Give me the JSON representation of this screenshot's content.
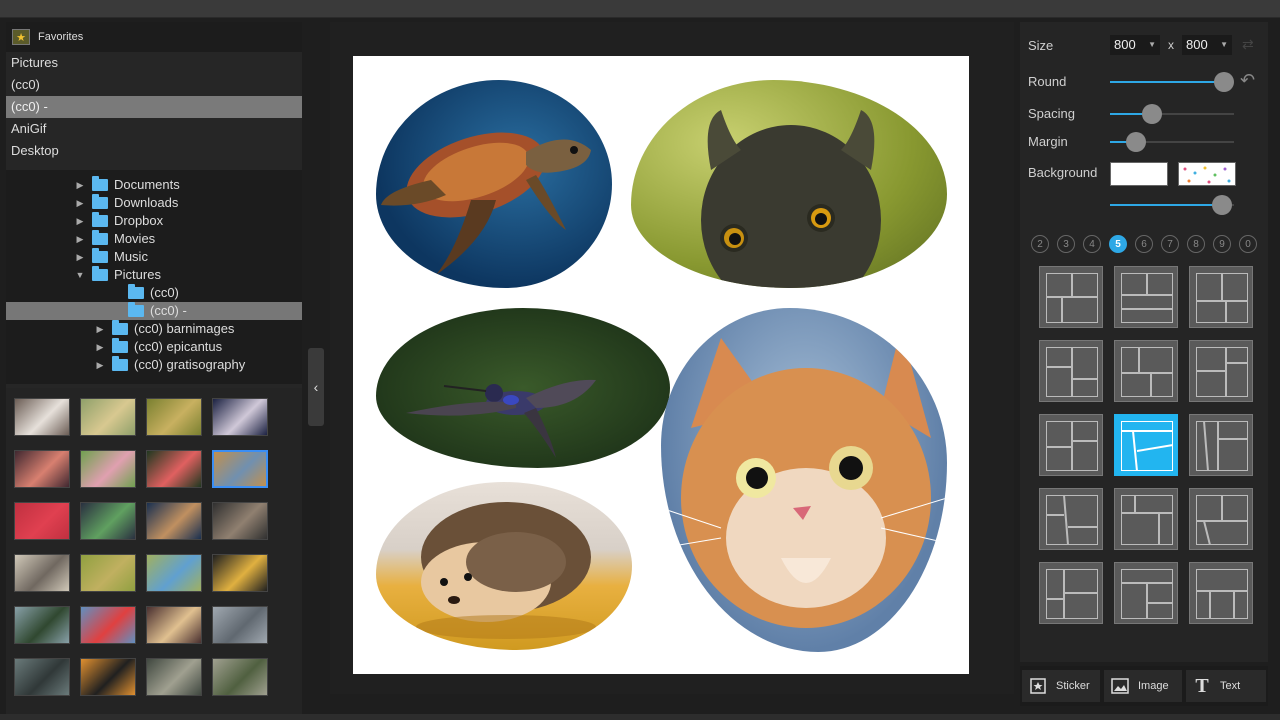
{
  "favorites": {
    "title": "Favorites",
    "items": [
      {
        "label": "Pictures",
        "selected": false
      },
      {
        "label": "(cc0)",
        "selected": false
      },
      {
        "label": "(cc0) -",
        "selected": true
      },
      {
        "label": "AniGif",
        "selected": false
      },
      {
        "label": "Desktop",
        "selected": false
      }
    ]
  },
  "tree": [
    {
      "label": "Documents",
      "expanded": false
    },
    {
      "label": "Downloads",
      "expanded": false
    },
    {
      "label": "Dropbox",
      "expanded": false
    },
    {
      "label": "Movies",
      "expanded": false
    },
    {
      "label": "Music",
      "expanded": false
    },
    {
      "label": "Pictures",
      "expanded": true
    },
    {
      "label": "(cc0)"
    },
    {
      "label": "(cc0) -",
      "selected": true
    },
    {
      "label": "(cc0) barnimages",
      "expanded": false
    },
    {
      "label": "(cc0) epicantus",
      "expanded": false
    },
    {
      "label": "(cc0) gratisography",
      "expanded": false
    }
  ],
  "thumbnails": {
    "selected_index": 7,
    "colors": [
      [
        "#6b5d55",
        "#e6e0da"
      ],
      [
        "#8fa06a",
        "#d8c890"
      ],
      [
        "#7a8030",
        "#c8b060"
      ],
      [
        "#1c2242",
        "#d0c8d8"
      ],
      [
        "#402830",
        "#d88070"
      ],
      [
        "#70a050",
        "#e0a0b0"
      ],
      [
        "#203820",
        "#e06060"
      ],
      [
        "#c09050",
        "#7090b0"
      ],
      [
        "#c03040",
        "#e04050"
      ],
      [
        "#2a3040",
        "#60a060"
      ],
      [
        "#1a3050",
        "#c09060"
      ],
      [
        "#303030",
        "#908070"
      ],
      [
        "#d0c8b8",
        "#706860"
      ],
      [
        "#90a040",
        "#c0b060"
      ],
      [
        "#a0b060",
        "#60a0d0"
      ],
      [
        "#202020",
        "#e0b040"
      ],
      [
        "#88a0a8",
        "#304830"
      ],
      [
        "#6090c0",
        "#e04040"
      ],
      [
        "#4a3030",
        "#e0c090"
      ],
      [
        "#a0a8b0",
        "#606870"
      ],
      [
        "#6a7a7a",
        "#303838"
      ],
      [
        "#e09030",
        "#202020"
      ],
      [
        "#404840",
        "#a0a090"
      ],
      [
        "#a0a090",
        "#506040"
      ]
    ]
  },
  "canvas": {
    "images": [
      "sea-turtle",
      "owl",
      "hummingbird",
      "hedgehog",
      "cat"
    ]
  },
  "panel": {
    "size_label": "Size",
    "width_value": "800",
    "x_label": "x",
    "height_value": "800",
    "round_label": "Round",
    "round_value": 1.0,
    "spacing_label": "Spacing",
    "spacing_value": 0.34,
    "margin_label": "Margin",
    "margin_value": 0.21,
    "background_label": "Background",
    "background_color": "#ffffff",
    "opacity_value": 0.9,
    "counts": [
      "2",
      "3",
      "4",
      "5",
      "6",
      "7",
      "8",
      "9",
      "0"
    ],
    "selected_count": "5",
    "selected_layout": 7,
    "accent": "#22b5f0"
  },
  "toolbar": {
    "sticker_label": "Sticker",
    "image_label": "Image",
    "text_label": "Text"
  }
}
